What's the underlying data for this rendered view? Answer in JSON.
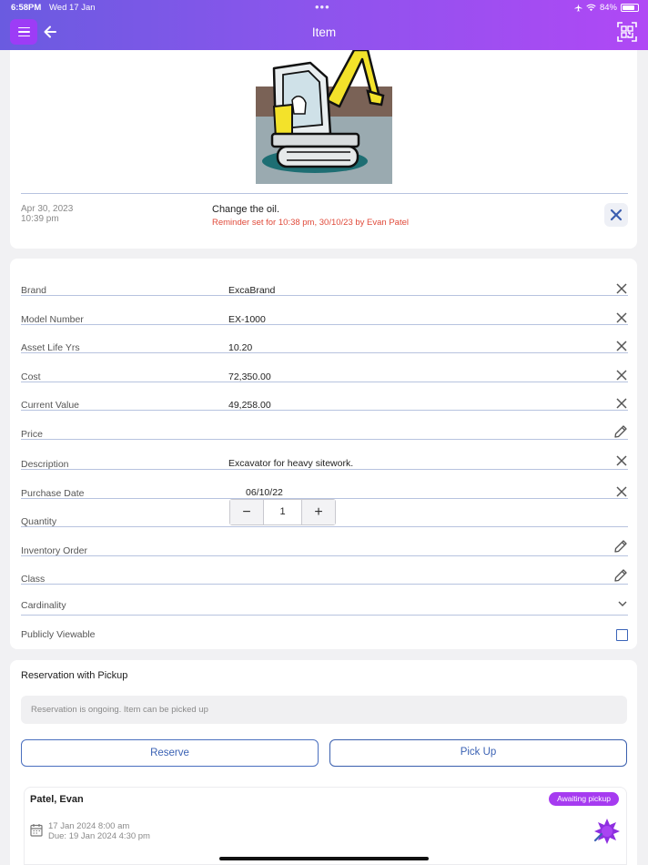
{
  "status_bar": {
    "time": "6:58PM",
    "date": "Wed 17 Jan",
    "dots": "•••",
    "battery": "84%",
    "battery_level": 0.84
  },
  "header": {
    "title": "Item"
  },
  "note": {
    "date": "Apr 30, 2023",
    "time": "10:39 pm",
    "text": "Change the oil.",
    "reminder": "Reminder set for 10:38 pm, 30/10/23 by Evan Patel"
  },
  "fields": [
    {
      "label": "Brand",
      "value": "ExcaBrand",
      "action": "clear"
    },
    {
      "label": "Model Number",
      "value": "EX-1000",
      "action": "clear"
    },
    {
      "label": "Asset Life Yrs",
      "value": "10.20",
      "action": "clear"
    },
    {
      "label": "Cost",
      "value": "72,350.00",
      "action": "clear"
    },
    {
      "label": "Current Value",
      "value": "49,258.00",
      "action": "clear"
    },
    {
      "label": "Price",
      "value": "",
      "action": "edit"
    },
    {
      "label": "Description",
      "value": "Excavator for heavy sitework.",
      "action": "clear"
    },
    {
      "label": "Purchase Date",
      "value": "06/10/22",
      "action": "clear"
    }
  ],
  "quantity": {
    "label": "Quantity",
    "value": "1",
    "minus": "−",
    "plus": "+"
  },
  "inventory_order": {
    "label": "Inventory Order"
  },
  "class_field": {
    "label": "Class"
  },
  "cardinality": {
    "label": "Cardinality"
  },
  "publicly_viewable": {
    "label": "Publicly Viewable",
    "checked": false
  },
  "reservation": {
    "title": "Reservation with Pickup",
    "info": "Reservation is ongoing. Item can be picked up",
    "reserve_label": "Reserve",
    "pickup_label": "Pick Up",
    "entry": {
      "name": "Patel, Evan",
      "status": "Awaiting pickup",
      "start": "17 Jan 2024 8:00 am",
      "due": "Due: 19 Jan 2024 4:30 pm"
    }
  },
  "colors": {
    "header_start": "#6a5be0",
    "header_end": "#b048f5",
    "accent": "#3b62b4",
    "reminder": "#e04a3a",
    "badge": "#a63bf0"
  }
}
